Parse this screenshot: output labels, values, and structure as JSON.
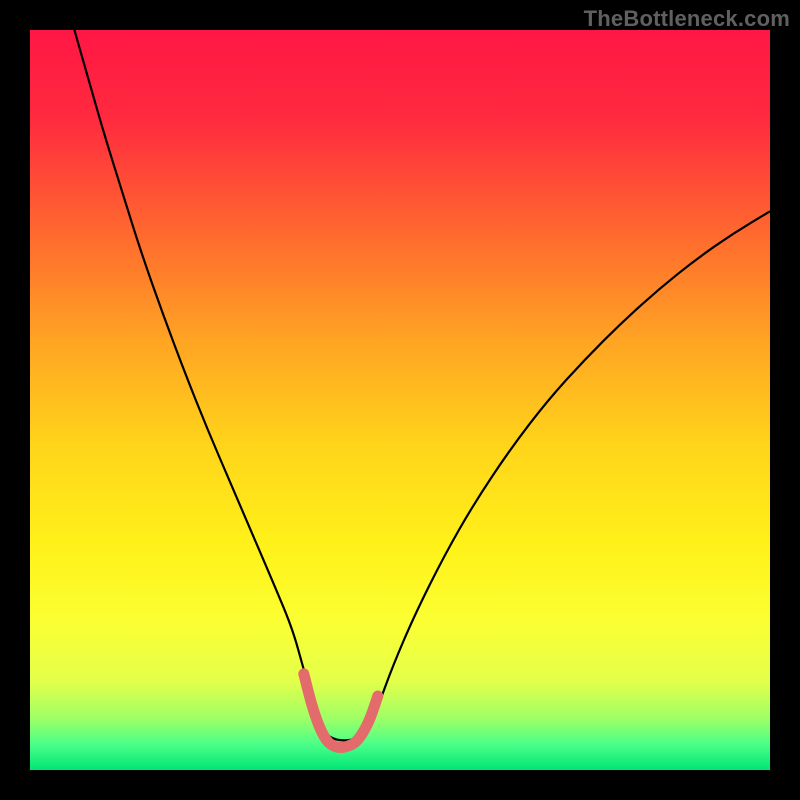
{
  "attribution": "TheBottleneck.com",
  "chart_data": {
    "type": "line",
    "title": "",
    "xlabel": "",
    "ylabel": "",
    "xlim": [
      0,
      100
    ],
    "ylim": [
      0,
      100
    ],
    "gradient_stops": [
      {
        "offset": 0.0,
        "color": "#ff1744"
      },
      {
        "offset": 0.12,
        "color": "#ff2a3f"
      },
      {
        "offset": 0.28,
        "color": "#ff6b2e"
      },
      {
        "offset": 0.42,
        "color": "#ffa423"
      },
      {
        "offset": 0.56,
        "color": "#ffd41a"
      },
      {
        "offset": 0.7,
        "color": "#fff21a"
      },
      {
        "offset": 0.8,
        "color": "#fbff33"
      },
      {
        "offset": 0.88,
        "color": "#e3ff4a"
      },
      {
        "offset": 0.93,
        "color": "#9fff66"
      },
      {
        "offset": 0.965,
        "color": "#4Bff88"
      },
      {
        "offset": 1.0,
        "color": "#00e676"
      }
    ],
    "series": [
      {
        "name": "bottleneck-curve",
        "color": "#000000",
        "width": 2.2,
        "x": [
          6.0,
          8.0,
          10.0,
          12.5,
          15.0,
          18.0,
          21.0,
          24.0,
          27.0,
          30.0,
          33.0,
          35.5,
          37.0,
          38.5,
          40.0,
          45.0,
          47.0,
          49.0,
          52.0,
          56.0,
          60.0,
          65.0,
          70.0,
          75.0,
          80.0,
          85.0,
          90.0,
          95.0,
          100.0
        ],
        "values": [
          100.0,
          93.0,
          86.0,
          78.0,
          70.0,
          61.5,
          53.5,
          46.0,
          39.0,
          32.0,
          25.0,
          19.0,
          13.5,
          8.5,
          4.0,
          4.0,
          8.5,
          14.0,
          21.0,
          29.0,
          36.0,
          43.5,
          50.0,
          55.5,
          60.5,
          65.0,
          69.0,
          72.5,
          75.5
        ]
      },
      {
        "name": "valley-highlight",
        "color": "#e36b6b",
        "width": 11,
        "linecap": "round",
        "x": [
          37.0,
          38.0,
          39.0,
          40.0,
          41.0,
          42.0,
          43.0,
          44.0,
          45.0,
          46.0,
          47.0
        ],
        "values": [
          13.0,
          9.0,
          6.0,
          4.0,
          3.2,
          3.0,
          3.2,
          3.7,
          5.0,
          7.0,
          10.0
        ]
      }
    ]
  }
}
